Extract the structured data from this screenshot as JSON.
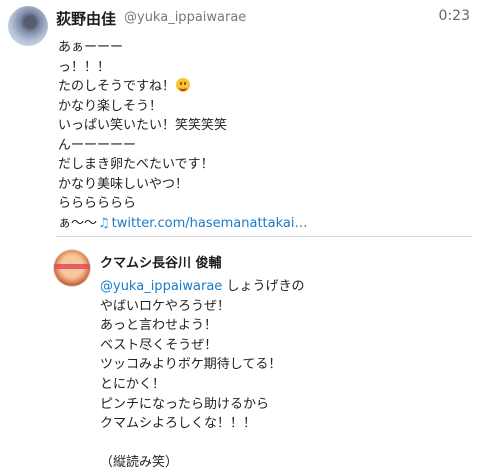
{
  "tweet": {
    "display_name": "荻野由佳",
    "handle": "@yuka_ippaiwarae",
    "timestamp": "0:23",
    "lines": [
      "あぁーーー",
      "っ！！！",
      "たのしそうですね！",
      "かなり楽しそう！",
      "いっぱい笑いたい！笑笑笑笑",
      "んーーーーー",
      "だしまき卵たべたいです！",
      "かなり美味しいやつ！",
      "らららららら",
      "ぁ〜〜"
    ],
    "line3_emoji_icon": "smiley-icon",
    "last_line_icon": "music-note-icon",
    "link_text": "twitter.com/hasemanattakai…"
  },
  "quoted": {
    "display_name": "クマムシ長谷川 俊輔",
    "mention": "@yuka_ippaiwarae",
    "first_line_text": " しょうげきの",
    "lines": [
      "やばいロケやろうぜ！",
      "あっと言わせよう！",
      "ベスト尽くそうぜ！",
      "ツッコみよりボケ期待してる！",
      "とにかく！",
      "ピンチになったら助けるから",
      "クマムシよろしくな！！！",
      "",
      "（縦読み笑）"
    ]
  }
}
